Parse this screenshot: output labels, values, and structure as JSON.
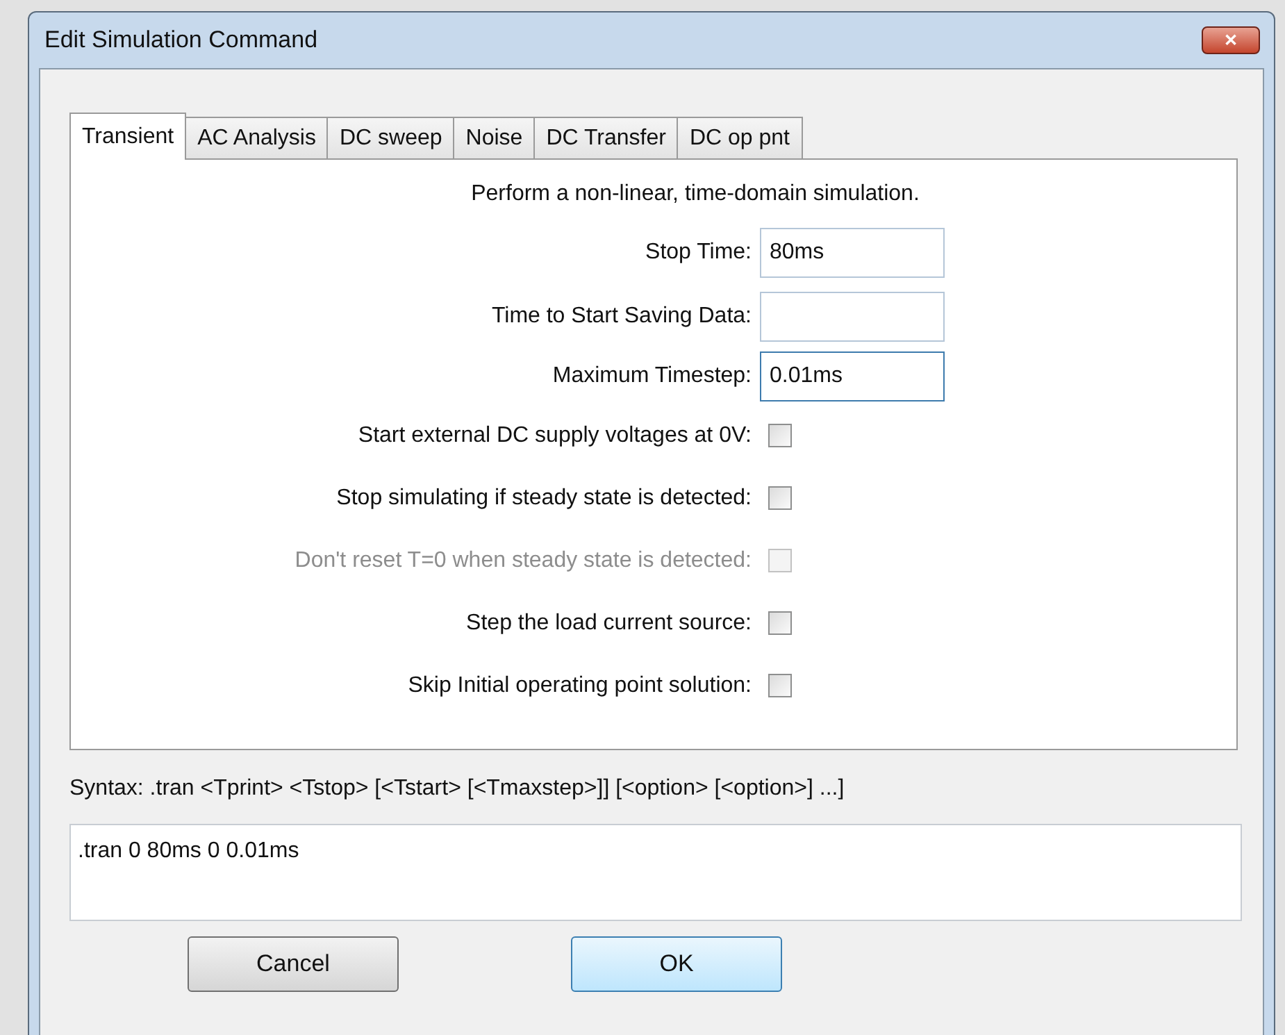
{
  "window": {
    "title": "Edit Simulation Command",
    "close": "✕"
  },
  "tabs": [
    {
      "label": "Transient",
      "selected": true
    },
    {
      "label": "AC Analysis",
      "selected": false
    },
    {
      "label": "DC sweep",
      "selected": false
    },
    {
      "label": "Noise",
      "selected": false
    },
    {
      "label": "DC Transfer",
      "selected": false
    },
    {
      "label": "DC op pnt",
      "selected": false
    }
  ],
  "description": "Perform a non-linear, time-domain simulation.",
  "fields": [
    {
      "label": "Stop Time:",
      "value": "80ms",
      "focused": false
    },
    {
      "label": "Time to Start Saving Data:",
      "focused": false
    },
    {
      "label": "Maximum Timestep:",
      "value": "0.01ms",
      "focused": true
    }
  ],
  "options": [
    {
      "label": "Start external DC supply voltages at 0V:",
      "checked": false,
      "disabled": false
    },
    {
      "label": "Stop simulating if steady state is detected:",
      "checked": false,
      "disabled": false
    },
    {
      "label": "Don't reset T=0 when steady state is detected:",
      "checked": false,
      "disabled": true
    },
    {
      "label": "Step the load current source:",
      "checked": false,
      "disabled": false
    },
    {
      "label": "Skip Initial operating point solution:",
      "checked": false,
      "disabled": false
    }
  ],
  "syntax": "Syntax:  .tran <Tprint> <Tstop> [<Tstart> [<Tmaxstep>]] [<option> [<option>] ...]",
  "command": ".tran 0 80ms 0 0.01ms",
  "buttons": [
    {
      "label": "Cancel",
      "default": false
    },
    {
      "label": "OK",
      "default": true
    }
  ]
}
